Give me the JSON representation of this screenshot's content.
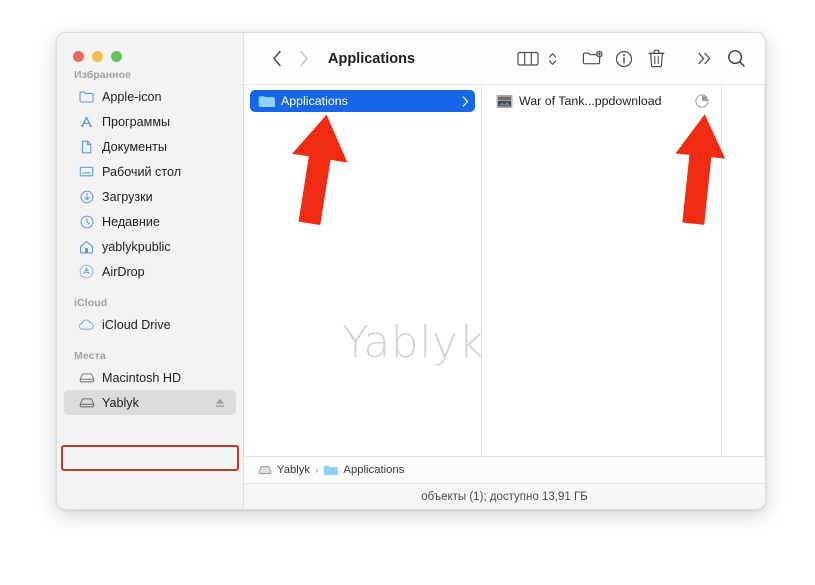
{
  "window": {
    "traffic_lights": [
      {
        "name": "close",
        "color": "#ED6A5E"
      },
      {
        "name": "minimize",
        "color": "#F4BE4F"
      },
      {
        "name": "maximize",
        "color": "#61C554"
      }
    ]
  },
  "toolbar": {
    "back_icon": "chevron-left-icon",
    "forward_icon": "chevron-right-icon",
    "title": "Applications",
    "view_icon": "column-view-icon",
    "view_chevrons_icon": "chevron-up-down-icon",
    "new_folder_icon": "new-folder-action-icon",
    "info_icon": "info-circle-icon",
    "trash_icon": "trash-icon",
    "more_icon": "double-chevron-right-icon",
    "search_icon": "search-icon"
  },
  "sidebar": {
    "sections": [
      {
        "title": "Избранное",
        "items": [
          {
            "label": "Apple-icon",
            "icon": "folder-icon"
          },
          {
            "label": "Программы",
            "icon": "applications-icon"
          },
          {
            "label": "Документы",
            "icon": "document-icon"
          },
          {
            "label": "Рабочий стол",
            "icon": "desktop-icon"
          },
          {
            "label": "Загрузки",
            "icon": "downloads-icon"
          },
          {
            "label": "Недавние",
            "icon": "clock-icon"
          },
          {
            "label": "yablykpublic",
            "icon": "home-icon"
          },
          {
            "label": "AirDrop",
            "icon": "airdrop-icon"
          }
        ]
      },
      {
        "title": "iCloud",
        "items": [
          {
            "label": "iCloud Drive",
            "icon": "cloud-icon"
          }
        ]
      },
      {
        "title": "Места",
        "items": [
          {
            "label": "Macintosh HD",
            "icon": "harddisk-icon",
            "selected": false,
            "eject": false
          },
          {
            "label": "Yablyk",
            "icon": "harddisk-icon",
            "selected": true,
            "eject": true
          }
        ]
      }
    ]
  },
  "columns": {
    "column1": [
      {
        "label": "Applications",
        "icon": "folder-icon",
        "selected": true,
        "chevron": true
      }
    ],
    "column2": [
      {
        "label": "War of Tank...ppdownload",
        "icon": "file-thumbnail-icon",
        "selected": false,
        "progress": 25
      }
    ],
    "column3": []
  },
  "watermark": "Yablyk",
  "pathbar": {
    "segments": [
      {
        "label": "Yablyk",
        "icon": "harddisk-icon"
      },
      {
        "label": "Applications",
        "icon": "folder-icon"
      }
    ],
    "separator": "›"
  },
  "statusbar": {
    "text": "объекты (1); доступно 13,91 ГБ"
  },
  "annotations": {
    "highlight_box_color": "#c0392b",
    "arrow_color": "#F02B11",
    "arrows": [
      {
        "name": "arrow-pointing-to-applications-row"
      },
      {
        "name": "arrow-pointing-to-download-progress"
      }
    ]
  }
}
